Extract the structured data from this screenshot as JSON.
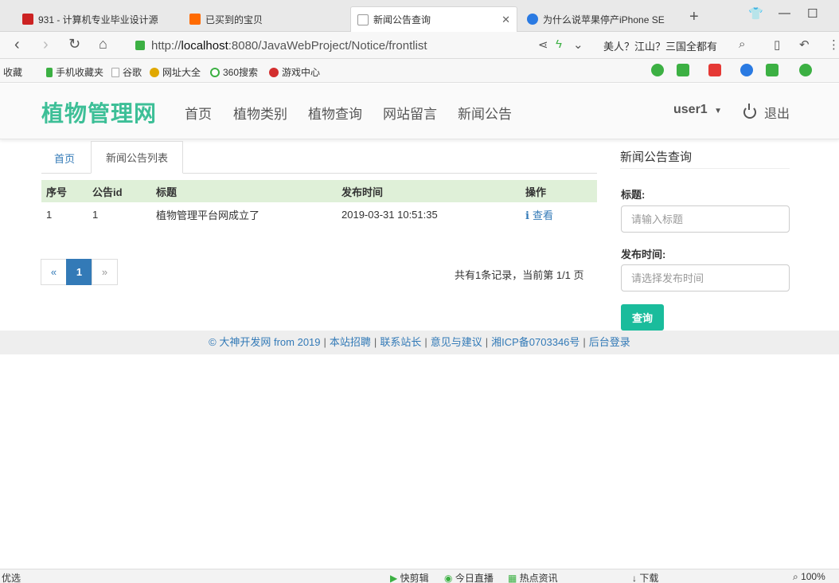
{
  "browser": {
    "tabs": [
      {
        "label": "931 - 计算机专业毕业设计源",
        "color": "#cc2222"
      },
      {
        "label": "已买到的宝贝",
        "color": "#ff6a00"
      },
      {
        "label": "新闻公告查询",
        "color": "#999999"
      },
      {
        "label": "为什么说苹果停产iPhone SE",
        "color": "#2a7ae2"
      }
    ],
    "new_tab": "+",
    "window_controls": {
      "shirt": "👕",
      "minimize": "—",
      "maximize": "☐"
    },
    "url_host_prefix": "http://",
    "url_host": "localhost",
    "url_path": ":8080/JavaWebProject/Notice/frontlist",
    "search_text": "美人？江山？三国全都有",
    "bookmarks": [
      {
        "label": "收藏",
        "color": "#f5b400"
      },
      {
        "label": "手机收藏夹",
        "color": "#3cb043"
      },
      {
        "label": "谷歌",
        "color": "#cccccc"
      },
      {
        "label": "网址大全",
        "color": "#e0a800"
      },
      {
        "label": "360搜索",
        "color": "#3cb043"
      },
      {
        "label": "游戏中心",
        "color": "#d32f2f"
      }
    ]
  },
  "site": {
    "brand": "植物管理网",
    "brand_color": "#3dbf97",
    "nav": [
      "首页",
      "植物类别",
      "植物查询",
      "网站留言",
      "新闻公告"
    ],
    "user": "user1",
    "logout": "退出"
  },
  "breadcrumb": {
    "home": "首页",
    "active": "新闻公告列表"
  },
  "table": {
    "headers": [
      "序号",
      "公告id",
      "标题",
      "发布时间",
      "操作"
    ],
    "rows": [
      {
        "no": "1",
        "id": "1",
        "title": "植物管理平台网成立了",
        "time": "2019-03-31 10:51:35",
        "action": "查看"
      }
    ]
  },
  "pagination": {
    "prev": "«",
    "current": "1",
    "next": "»",
    "info": "共有1条记录，当前第 1/1 页"
  },
  "search_panel": {
    "title": "新闻公告查询",
    "title_label": "标题:",
    "title_placeholder": "请输入标题",
    "time_label": "发布时间:",
    "time_placeholder": "请选择发布时间",
    "button": "查询",
    "button_color": "#1abc9c"
  },
  "footer": {
    "copyright": "© 大神开发网 from 2019",
    "links": [
      "本站招聘",
      "联系站长",
      "意见与建议",
      "湘ICP备0703346号",
      "后台登录"
    ]
  },
  "statusbar": {
    "left": "优选",
    "items": [
      "快剪辑",
      "今日直播",
      "热点资讯",
      "下载"
    ],
    "zoom": "100%"
  }
}
